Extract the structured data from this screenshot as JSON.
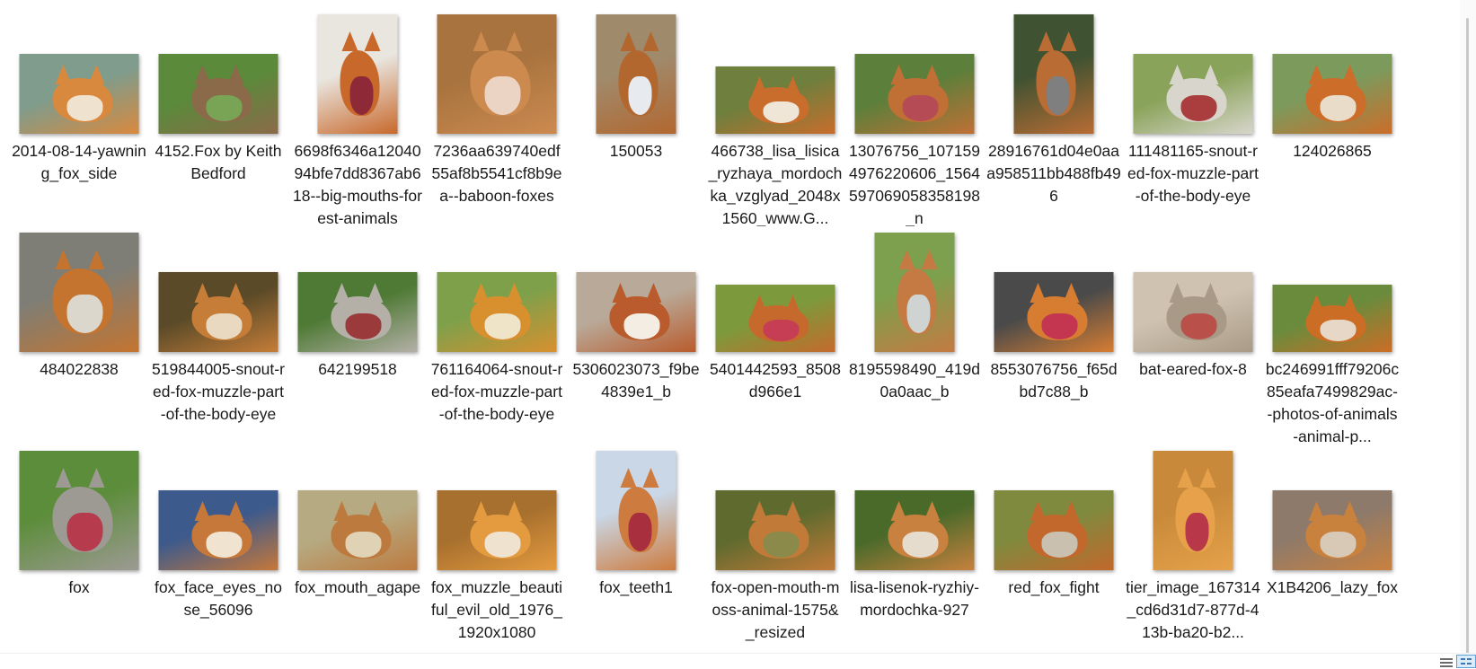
{
  "files": [
    {
      "name": "2014-08-14-yawning_fox_side",
      "shape": "land",
      "colors": [
        "#7f9c8c",
        "#d9893e",
        "#efe2cf"
      ]
    },
    {
      "name": "4152.Fox by Keith Bedford",
      "shape": "land",
      "colors": [
        "#5a8a3a",
        "#8b6a4a",
        "#79a455"
      ]
    },
    {
      "name": "6698f6346a1204094bfe7dd8367ab618--big-mouths-forest-animals",
      "shape": "port",
      "colors": [
        "#e9e6e0",
        "#c8682b",
        "#8e2a37"
      ]
    },
    {
      "name": "7236aa639740edf55af8b5541cf8b9ea--baboon-foxes",
      "shape": "sq",
      "colors": [
        "#a8733f",
        "#cc8a4f",
        "#ebd4c3"
      ]
    },
    {
      "name": "150053",
      "shape": "port",
      "colors": [
        "#a08a6c",
        "#b2672f",
        "#e7ebf0"
      ]
    },
    {
      "name": "466738_lisa_lisica_ryzhaya_mordochka_vzglyad_2048x1560_www.G...",
      "shape": "wide",
      "colors": [
        "#6f7f3d",
        "#c86d2c",
        "#f0e6d8"
      ]
    },
    {
      "name": "13076756_1071594976220606_1564597069058358198_n",
      "shape": "land",
      "colors": [
        "#5c7f3b",
        "#c07035",
        "#b54b55"
      ]
    },
    {
      "name": "28916761d04e0aaa958511bb488fb496",
      "shape": "port",
      "colors": [
        "#3f5231",
        "#b96c34",
        "#7f7f7f"
      ]
    },
    {
      "name": "111481165-snout-red-fox-muzzle-part-of-the-body-eye",
      "shape": "land",
      "colors": [
        "#8aa35a",
        "#d8d6cc",
        "#aa3d3d"
      ]
    },
    {
      "name": "124026865",
      "shape": "land",
      "colors": [
        "#7c9a5c",
        "#cc6d2a",
        "#e9ddc9"
      ]
    },
    {
      "name": "484022838",
      "shape": "sq",
      "colors": [
        "#7e7e76",
        "#c4742f",
        "#dcd7cd"
      ]
    },
    {
      "name": "519844005-snout-red-fox-muzzle-part-of-the-body-eye",
      "shape": "land",
      "colors": [
        "#5a4a28",
        "#c57d38",
        "#e8d9c0"
      ]
    },
    {
      "name": "642199518",
      "shape": "land",
      "colors": [
        "#4f7a35",
        "#b4b0a8",
        "#9a3a3a"
      ]
    },
    {
      "name": "761164064-snout-red-fox-muzzle-part-of-the-body-eye",
      "shape": "land",
      "colors": [
        "#7fa04a",
        "#d8902f",
        "#efe3c8"
      ]
    },
    {
      "name": "5306023073_f9be4839e1_b",
      "shape": "land",
      "colors": [
        "#b9a998",
        "#b95b2c",
        "#f4ede4"
      ]
    },
    {
      "name": "5401442593_8508d966e1",
      "shape": "wide",
      "colors": [
        "#7c9a3c",
        "#c56a2c",
        "#c63e53"
      ]
    },
    {
      "name": "8195598490_419d0a0aac_b",
      "shape": "port",
      "colors": [
        "#7ca04d",
        "#c47a42",
        "#cfd4d2"
      ]
    },
    {
      "name": "8553076756_f65dbd7c88_b",
      "shape": "land",
      "colors": [
        "#4a4a4a",
        "#d77d32",
        "#c43550"
      ]
    },
    {
      "name": "bat-eared-fox-8",
      "shape": "land",
      "colors": [
        "#cfc2b0",
        "#a89a86",
        "#b9504a"
      ]
    },
    {
      "name": "bc246991fff79206c85eafa7499829ac--photos-of-animals-animal-p...",
      "shape": "wide",
      "colors": [
        "#6b8b3c",
        "#cc6d26",
        "#e7d7c6"
      ]
    },
    {
      "name": "fox",
      "shape": "sq",
      "colors": [
        "#5c8d3a",
        "#9d9a94",
        "#b63b4c"
      ]
    },
    {
      "name": "fox_face_eyes_nose_56096",
      "shape": "land",
      "colors": [
        "#3d5a8c",
        "#c6783a",
        "#f0e4d0"
      ]
    },
    {
      "name": "fox_mouth_agape",
      "shape": "land",
      "colors": [
        "#b6aa82",
        "#bd7a3e",
        "#e0d2b4"
      ]
    },
    {
      "name": "fox_muzzle_beautiful_evil_old_1976_1920x1080",
      "shape": "land",
      "colors": [
        "#a8702e",
        "#e49b3f",
        "#efe3cf"
      ]
    },
    {
      "name": "fox_teeth1",
      "shape": "port",
      "colors": [
        "#c9d7e6",
        "#cd7b3e",
        "#a82f3e"
      ]
    },
    {
      "name": "fox-open-mouth-moss-animal-1575&_resized",
      "shape": "land",
      "colors": [
        "#5f6a2e",
        "#c27a38",
        "#8c8a4a"
      ]
    },
    {
      "name": "lisa-lisenok-ryzhiy-mordochka-927",
      "shape": "land",
      "colors": [
        "#4a6a2a",
        "#c8813e",
        "#e5dccd"
      ]
    },
    {
      "name": "red_fox_fight",
      "shape": "land",
      "colors": [
        "#7f8a3e",
        "#c2682c",
        "#c9c0b0"
      ]
    },
    {
      "name": "tier_image_167314_cd6d31d7-877d-413b-ba20-b2...",
      "shape": "port",
      "colors": [
        "#c88a3a",
        "#e6a14a",
        "#b8384a"
      ]
    },
    {
      "name": "X1B4206_lazy_fox",
      "shape": "land",
      "colors": [
        "#8e7a6a",
        "#c9813e",
        "#d8c8b6"
      ]
    }
  ],
  "icons": {
    "details_view": "details-view-icon",
    "large_icons_view": "large-icons-view-icon"
  }
}
